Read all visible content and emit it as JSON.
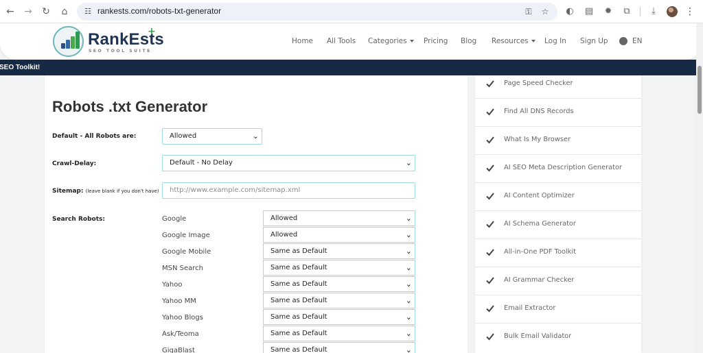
{
  "browser": {
    "url": "rankests.com/robots-txt-generator"
  },
  "site": {
    "brand": "RankEsts",
    "tagline": "SEO TOOL SUITE"
  },
  "nav": {
    "home": "Home",
    "all_tools": "All Tools",
    "categories": "Categories",
    "pricing": "Pricing",
    "blog": "Blog",
    "resources": "Resources",
    "login": "Log In",
    "signup": "Sign Up",
    "language": "EN"
  },
  "banner": {
    "text": "SEO Toolkit!"
  },
  "form": {
    "title": "Robots .txt Generator",
    "default_label": "Default - All Robots are:",
    "default_value": "Allowed",
    "crawl_label": "Crawl-Delay:",
    "crawl_value": "Default - No Delay",
    "sitemap_label": "Sitemap:",
    "sitemap_hint": "(leave blank if you don't have)",
    "sitemap_placeholder": "http://www.example.com/sitemap.xml",
    "search_robots_label": "Search Robots:",
    "robots": [
      {
        "name": "Google",
        "value": "Allowed"
      },
      {
        "name": "Google Image",
        "value": "Allowed"
      },
      {
        "name": "Google Mobile",
        "value": "Same as Default"
      },
      {
        "name": "MSN Search",
        "value": "Same as Default"
      },
      {
        "name": "Yahoo",
        "value": "Same as Default"
      },
      {
        "name": "Yahoo MM",
        "value": "Same as Default"
      },
      {
        "name": "Yahoo Blogs",
        "value": "Same as Default"
      },
      {
        "name": "Ask/Teoma",
        "value": "Same as Default"
      },
      {
        "name": "GigaBlast",
        "value": "Same as Default"
      }
    ]
  },
  "sidebar": {
    "items": [
      "Page Speed Checker",
      "Find All DNS Records",
      "What Is My Browser",
      "AI SEO Meta Description Generator",
      "AI Content Optimizer",
      "AI Schema Generator",
      "All-in-One PDF Toolkit",
      "AI Grammar Checker",
      "Email Extractor",
      "Bulk Email Validator"
    ]
  },
  "icons": {
    "back": "back-arrow-icon",
    "forward": "forward-arrow-icon",
    "reload": "reload-icon",
    "home": "home-icon",
    "key": "key-icon",
    "bookmark": "star-icon",
    "downloads": "download-icon",
    "menu": "more-vertical-icon"
  },
  "colors": {
    "banner": "#172a45",
    "accent_green": "#37a346",
    "field_border": "#9fdbe1"
  }
}
